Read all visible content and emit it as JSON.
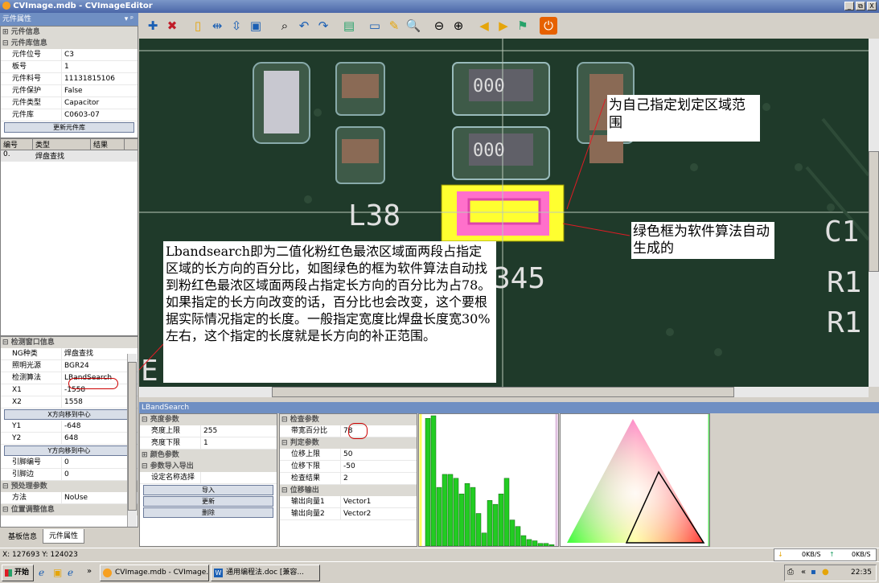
{
  "window": {
    "title": "CVImage.mdb - CVImageEditor",
    "btn_min": "_",
    "btn_max": "⧉",
    "btn_close": "X"
  },
  "left": {
    "header": "元件属性",
    "header_icons": "▾ ᵖ",
    "sec_component": "元件信息",
    "sec_library": "元件库信息",
    "lib_rows": [
      {
        "k": "元件位号",
        "v": "C3"
      },
      {
        "k": "板号",
        "v": "1"
      },
      {
        "k": "元件料号",
        "v": "11131815106"
      },
      {
        "k": "元件保护",
        "v": "False"
      },
      {
        "k": "元件类型",
        "v": "Capacitor"
      },
      {
        "k": "元件库",
        "v": "C0603-07"
      }
    ],
    "update_btn": "更新元件库",
    "list_headers": [
      "编号",
      "类型",
      "结果"
    ],
    "list_rows": [
      {
        "num": "0.",
        "type": "焊盘查找",
        "result": ""
      }
    ],
    "sec_detect": "检测窗口信息",
    "detect_rows": [
      {
        "k": "NG种类",
        "v": "焊盘查找"
      },
      {
        "k": "照明光源",
        "v": "BGR24"
      },
      {
        "k": "检测算法",
        "v": "LBandSearch"
      },
      {
        "k": "X1",
        "v": "-1558"
      },
      {
        "k": "X2",
        "v": "1558"
      }
    ],
    "x_center_btn": "X方向移到中心",
    "y_rows": [
      {
        "k": "Y1",
        "v": "-648"
      },
      {
        "k": "Y2",
        "v": "648"
      }
    ],
    "y_center_btn": "Y方向移到中心",
    "pin_rows": [
      {
        "k": "引脚编号",
        "v": "0"
      },
      {
        "k": "引脚边",
        "v": "0"
      }
    ],
    "sec_pre": "预处理参数",
    "method": {
      "k": "方法",
      "v": "NoUse"
    },
    "sec_pos": "位置调整信息",
    "tabs": [
      "基板信息",
      "元件属性"
    ]
  },
  "canvas": {
    "label_l36": "L38",
    "label_345": "345",
    "label_c1": "C1",
    "label_r1a": "R1",
    "label_r1b": "R1",
    "label_e": "E",
    "label_000a": "000",
    "label_000b": "000",
    "callout_top": "为自己指定划定区域范围",
    "callout_green": "绿色框为软件算法自动生成的",
    "callout_main": "Lbandsearch即为二值化粉红色最浓区域面两段占指定区域的长方向的百分比，如图绿色的框为软件算法自动找到粉红色最浓区域面两段占指定长方向的百分比为占78。如果指定的长方向改变的话，百分比也会改变，这个要根据实际情况指定的长度。一般指定宽度比焊盘长度宽30%左右，这个指定的长度就是长方向的补正范围。"
  },
  "lband": {
    "title": "LBandSearch",
    "sec_bright": "亮度参数",
    "bright_rows": [
      {
        "k": "亮度上限",
        "v": "255"
      },
      {
        "k": "亮度下限",
        "v": "1"
      }
    ],
    "sec_color": "颜色参数",
    "sec_io": "参数导入导出",
    "io_row": "设定名称选择",
    "btn_import": "导入",
    "btn_update": "更新",
    "btn_delete": "删除",
    "sec_check": "检查参数",
    "check_rows": [
      {
        "k": "带宽百分比",
        "v": "78"
      }
    ],
    "sec_judge": "判定参数",
    "judge_rows": [
      {
        "k": "位移上限",
        "v": "50"
      },
      {
        "k": "位移下限",
        "v": "-50"
      },
      {
        "k": "检查结果",
        "v": "2"
      }
    ],
    "sec_out": "位移输出",
    "out_rows": [
      {
        "k": "输出向量1",
        "v": "Vector1"
      },
      {
        "k": "输出向量2",
        "v": "Vector2"
      }
    ]
  },
  "chart_data": {
    "type": "bar",
    "values": [
      98,
      100,
      45,
      55,
      55,
      52,
      40,
      48,
      45,
      25,
      10,
      35,
      32,
      40,
      52,
      20,
      15,
      8,
      5,
      4,
      2,
      2,
      1
    ]
  },
  "status": {
    "coords": "X: 127693 Y: 124023",
    "down": "0KB/S",
    "up": "0KB/S"
  },
  "taskbar": {
    "start": "开始",
    "task1": "CVImage.mdb - CVImage...",
    "task2": "通用编程法.doc [兼容...",
    "time": "22:35",
    "arrows": "»"
  }
}
